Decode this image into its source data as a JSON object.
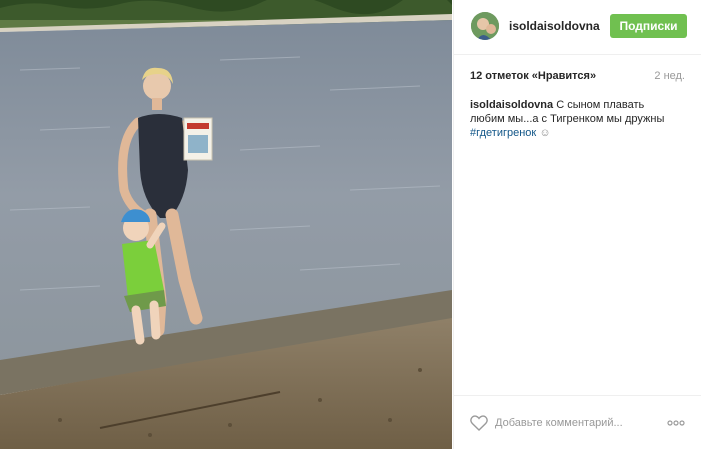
{
  "post": {
    "username": "isoldaisoldovna",
    "follow_label": "Подписки",
    "likes": "12 отметок «Нравится»",
    "time_ago": "2 нед.",
    "caption_user": "isoldaisoldovna",
    "caption_text": "С сыном плавать любим мы...а с Тигренком мы дружны",
    "hashtag": "#гдетигренок",
    "emoji": "☺",
    "comment_placeholder": "Добавьте комментарий...",
    "more_icon": "more-dots-icon",
    "like_icon": "heart-outline-icon"
  },
  "colors": {
    "follow_button": "#70c050",
    "hashtag": "#125688",
    "water": "#8a95a2",
    "sand": "#8a7a60"
  }
}
